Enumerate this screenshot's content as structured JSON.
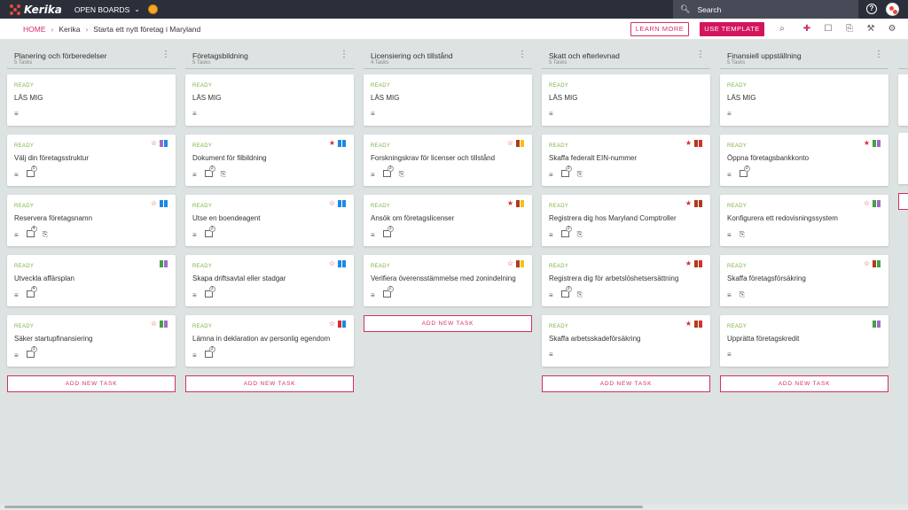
{
  "app": {
    "name": "Kerika",
    "open_boards": "OPEN BOARDS"
  },
  "search": {
    "label": "Search"
  },
  "breadcrumb": {
    "home": "HOME",
    "org": "Kerika",
    "board": "Starta ett nytt företag i Maryland"
  },
  "buttons": {
    "learn_more": "LEARN MORE",
    "use_template": "USE TEMPLATE",
    "add_task": "ADD NEW TASK"
  },
  "colors": {
    "accent": "#d3155d",
    "ready": "#7cb342",
    "topbar": "#2b2f3a",
    "background": "#dde3e2"
  },
  "columns": [
    {
      "title": "Planering och förberedelser",
      "count": "5 Tasks",
      "cards": [
        {
          "status": "READY",
          "title": "LÄS MIG",
          "icons": [
            "desc"
          ],
          "star": null,
          "tags": []
        },
        {
          "status": "READY",
          "title": "Välj din företagsstruktur",
          "icons": [
            "desc",
            "check:5"
          ],
          "star": "empty",
          "tags": [
            "#a06ac8",
            "#1e88e5"
          ]
        },
        {
          "status": "READY",
          "title": "Reservera företagsnamn",
          "icons": [
            "desc",
            "check:4",
            "attach"
          ],
          "star": "empty",
          "tags": [
            "#1e88e5",
            "#1e88e5"
          ]
        },
        {
          "status": "READY",
          "title": "Utveckla affärsplan",
          "icons": [
            "desc",
            "check:4"
          ],
          "star": null,
          "tags": [
            "#43a047",
            "#a06ac8"
          ]
        },
        {
          "status": "READY",
          "title": "Säker startupfinansiering",
          "icons": [
            "desc",
            "check:3"
          ],
          "star": "empty",
          "tags": [
            "#43a047",
            "#a06ac8"
          ]
        }
      ]
    },
    {
      "title": "Företagsbildning",
      "count": "5 Tasks",
      "cards": [
        {
          "status": "READY",
          "title": "LÄS MIG",
          "icons": [
            "desc"
          ],
          "star": null,
          "tags": []
        },
        {
          "status": "READY",
          "title": "Dokument för filbildning",
          "icons": [
            "desc",
            "check:3",
            "attach"
          ],
          "star": "full",
          "tags": [
            "#1e88e5",
            "#1e88e5"
          ]
        },
        {
          "status": "READY",
          "title": "Utse en boendeagent",
          "icons": [
            "desc",
            "check:3"
          ],
          "star": "empty",
          "tags": [
            "#1e88e5",
            "#1e88e5"
          ]
        },
        {
          "status": "READY",
          "title": "Skapa driftsavtal eller stadgar",
          "icons": [
            "desc",
            "check:3"
          ],
          "star": "empty",
          "tags": [
            "#1e88e5",
            "#1e88e5"
          ]
        },
        {
          "status": "READY",
          "title": "Lämna in deklaration av personlig egendom",
          "icons": [
            "desc",
            "check:3"
          ],
          "star": "empty",
          "tags": [
            "#d32f2f",
            "#1e88e5"
          ]
        }
      ]
    },
    {
      "title": "Licensiering och tillstånd",
      "count": "4 Tasks",
      "cards": [
        {
          "status": "READY",
          "title": "LÄS MIG",
          "icons": [
            "desc"
          ],
          "star": null,
          "tags": []
        },
        {
          "status": "READY",
          "title": "Forskningskrav för licenser och tillstånd",
          "icons": [
            "desc",
            "check:3",
            "attach"
          ],
          "star": "empty",
          "tags": [
            "#b23a1c",
            "#f4c20d"
          ]
        },
        {
          "status": "READY",
          "title": "Ansök om företagslicenser",
          "icons": [
            "desc",
            "check:3"
          ],
          "star": "full",
          "tags": [
            "#b23a1c",
            "#f4c20d"
          ]
        },
        {
          "status": "READY",
          "title": "Verifiera överensstämmelse med zonindelning",
          "icons": [
            "desc",
            "check:2"
          ],
          "star": "empty",
          "tags": [
            "#b23a1c",
            "#f4c20d"
          ]
        }
      ]
    },
    {
      "title": "Skatt och efterlevnad",
      "count": "5 Tasks",
      "cards": [
        {
          "status": "READY",
          "title": "LÄS MIG",
          "icons": [
            "desc"
          ],
          "star": null,
          "tags": []
        },
        {
          "status": "READY",
          "title": "Skaffa federalt EIN-nummer",
          "icons": [
            "desc",
            "check:3",
            "attach"
          ],
          "star": "full",
          "tags": [
            "#b23a1c",
            "#d32f2f"
          ]
        },
        {
          "status": "READY",
          "title": "Registrera dig hos Maryland Comptroller",
          "icons": [
            "desc",
            "check:3",
            "attach"
          ],
          "star": "full",
          "tags": [
            "#b23a1c",
            "#b23a1c"
          ]
        },
        {
          "status": "READY",
          "title": "Registrera dig för arbetslöshetsersättning",
          "icons": [
            "desc",
            "check:3",
            "attach"
          ],
          "star": "full",
          "tags": [
            "#b23a1c",
            "#d32f2f"
          ]
        },
        {
          "status": "READY",
          "title": "Skaffa arbetsskadeförsäkring",
          "icons": [
            "desc"
          ],
          "star": "full",
          "tags": [
            "#b23a1c",
            "#d32f2f"
          ]
        }
      ]
    },
    {
      "title": "Finansiell uppställning",
      "count": "5 Tasks",
      "cards": [
        {
          "status": "READY",
          "title": "LÄS MIG",
          "icons": [
            "desc"
          ],
          "star": null,
          "tags": []
        },
        {
          "status": "READY",
          "title": "Öppna företagsbankkonto",
          "icons": [
            "desc",
            "check:3"
          ],
          "star": "full",
          "tags": [
            "#43a047",
            "#a06ac8"
          ]
        },
        {
          "status": "READY",
          "title": "Konfigurera ett redovisningssystem",
          "icons": [
            "desc",
            "attach"
          ],
          "star": "empty",
          "tags": [
            "#43a047",
            "#a06ac8"
          ]
        },
        {
          "status": "READY",
          "title": "Skaffa företagsförsäkring",
          "icons": [
            "desc",
            "attach"
          ],
          "star": "empty",
          "tags": [
            "#b23a1c",
            "#43a047"
          ]
        },
        {
          "status": "READY",
          "title": "Upprätta företagskredit",
          "icons": [
            "desc"
          ],
          "star": null,
          "tags": [
            "#43a047",
            "#a06ac8"
          ]
        }
      ]
    }
  ]
}
